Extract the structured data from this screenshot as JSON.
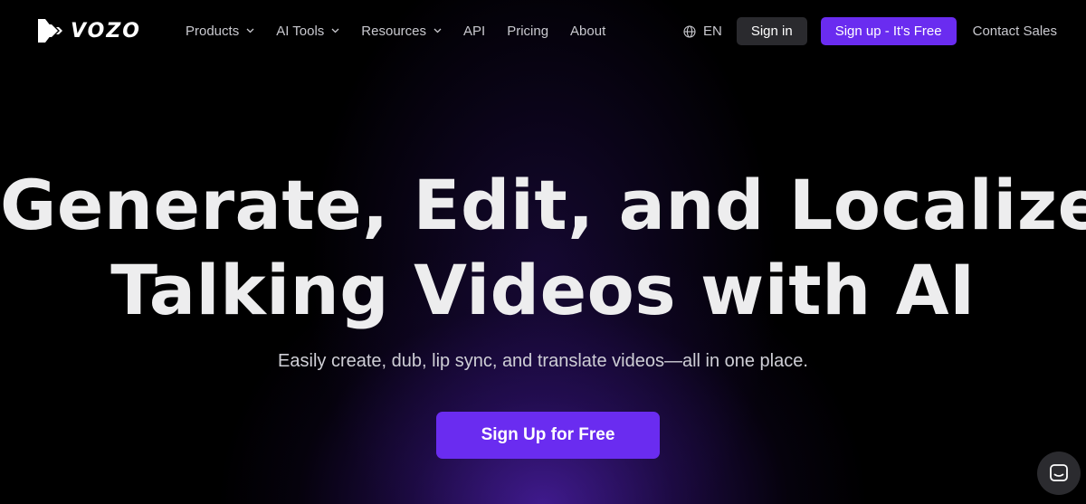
{
  "brand": {
    "name": "VOZO"
  },
  "nav": {
    "items": [
      {
        "label": "Products",
        "dropdown": true
      },
      {
        "label": "AI Tools",
        "dropdown": true
      },
      {
        "label": "Resources",
        "dropdown": true
      },
      {
        "label": "API",
        "dropdown": false
      },
      {
        "label": "Pricing",
        "dropdown": false
      },
      {
        "label": "About",
        "dropdown": false
      }
    ],
    "language": "EN",
    "signin_label": "Sign in",
    "signup_label": "Sign up - It's Free",
    "contact_label": "Contact Sales"
  },
  "hero": {
    "title_line1": "Generate, Edit, and Localize",
    "title_line2": "Talking Videos with AI",
    "subtitle": "Easily create, dub, lip sync, and translate videos—all in one place.",
    "cta_label": "Sign Up for Free"
  },
  "icons": {
    "logo": "vozo-logo-mark",
    "dropdown": "chevron-down-icon",
    "language": "globe-icon",
    "chat": "chat-bubble-icon"
  },
  "colors": {
    "accent": "#6a2cf0",
    "background": "#000000",
    "signin_button": "#2a2a2e",
    "nav_text": "#c9c9cf",
    "title_text": "#ededee"
  }
}
